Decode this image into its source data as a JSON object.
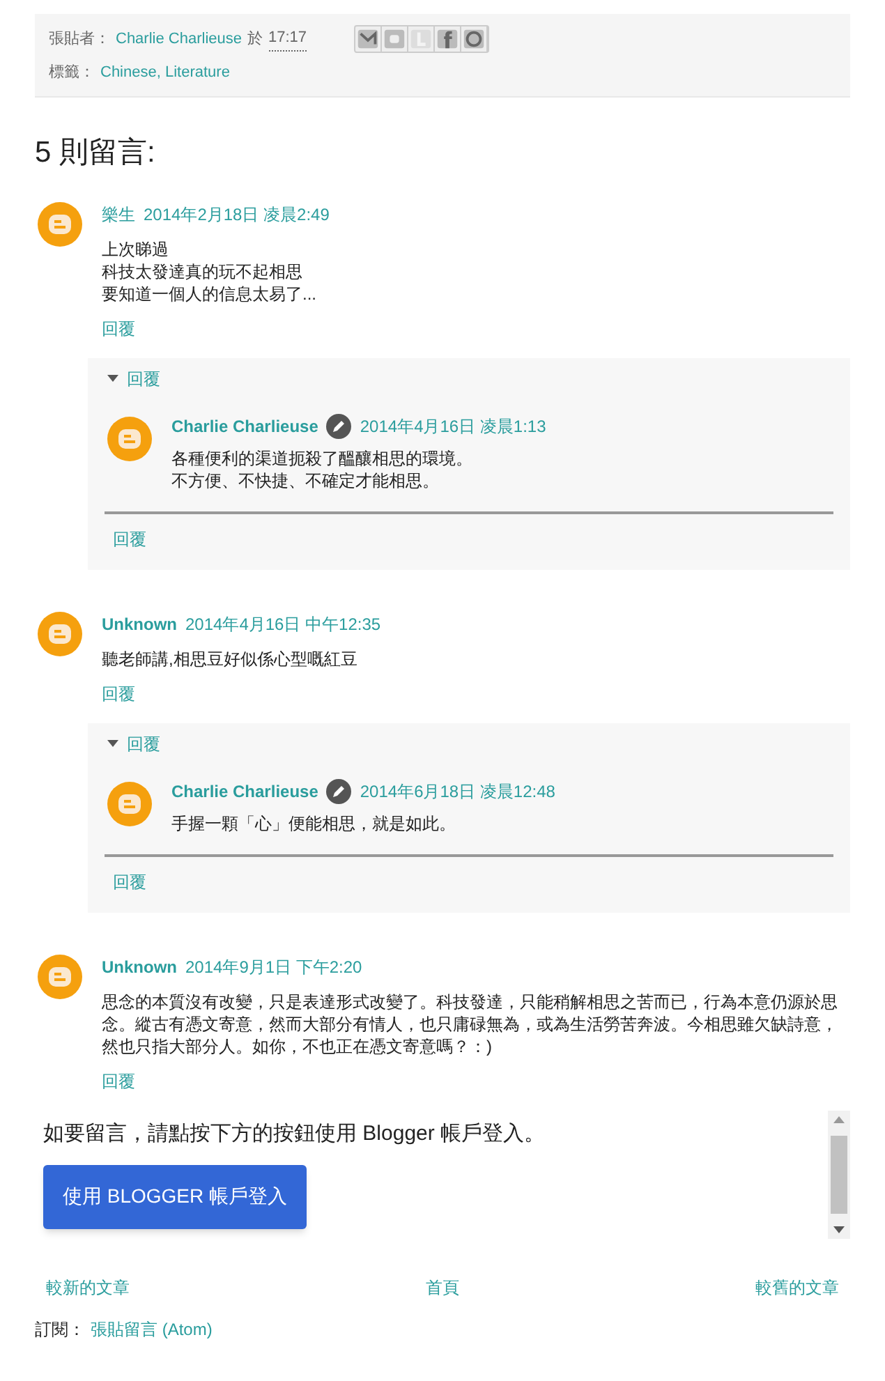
{
  "post_footer": {
    "author_label": "張貼者：",
    "author": "Charlie Charlieuse",
    "at": "於",
    "time": "17:17",
    "labels_label": "標籤：",
    "labels": "Chinese, Literature"
  },
  "comments_heading": "5 則留言:",
  "comments": [
    {
      "author": "樂生",
      "bold": false,
      "is_author": false,
      "date": "2014年2月18日 凌晨2:49",
      "lines": [
        "上次睇過",
        "科技太發達真的玩不起相思",
        "要知道一個人的信息太易了..."
      ],
      "reply_link": "回覆",
      "thread": {
        "toggle": "回覆",
        "expanded": true,
        "replies": [
          {
            "author": "Charlie Charlieuse",
            "bold": true,
            "is_author": true,
            "date": "2014年4月16日 凌晨1:13",
            "lines": [
              "各種便利的渠道扼殺了醞釀相思的環境。",
              "不方便、不快捷、不確定才能相思。"
            ]
          }
        ],
        "reply_link": "回覆"
      }
    },
    {
      "author": "Unknown",
      "bold": true,
      "is_author": false,
      "date": "2014年4月16日 中午12:35",
      "lines": [
        "聽老師講,相思豆好似係心型嘅紅豆"
      ],
      "reply_link": "回覆",
      "thread": {
        "toggle": "回覆",
        "expanded": true,
        "replies": [
          {
            "author": "Charlie Charlieuse",
            "bold": true,
            "is_author": true,
            "date": "2014年6月18日 凌晨12:48",
            "lines": [
              "手握一顆「心」便能相思，就是如此。"
            ]
          }
        ],
        "reply_link": "回覆"
      }
    },
    {
      "author": "Unknown",
      "bold": true,
      "is_author": false,
      "date": "2014年9月1日 下午2:20",
      "lines": [
        "思念的本質沒有改變，只是表達形式改變了。科技發達，只能稍解相思之苦而已，行為本意仍源於思念。縱古有憑文寄意，然而大部分有情人，也只庸碌無為，或為生活勞苦奔波。今相思雖欠缺詩意，然也只指大部分人。如你，不也正在憑文寄意嗎？：)"
      ],
      "reply_link": "回覆"
    }
  ],
  "login": {
    "prompt": "如要留言，請點按下方的按鈕使用 Blogger 帳戶登入。",
    "button": "使用 BLOGGER 帳戶登入"
  },
  "pager": {
    "newer": "較新的文章",
    "home": "首頁",
    "older": "較舊的文章"
  },
  "subscribe": {
    "label": "訂閱：",
    "link": "張貼留言 (Atom)"
  }
}
